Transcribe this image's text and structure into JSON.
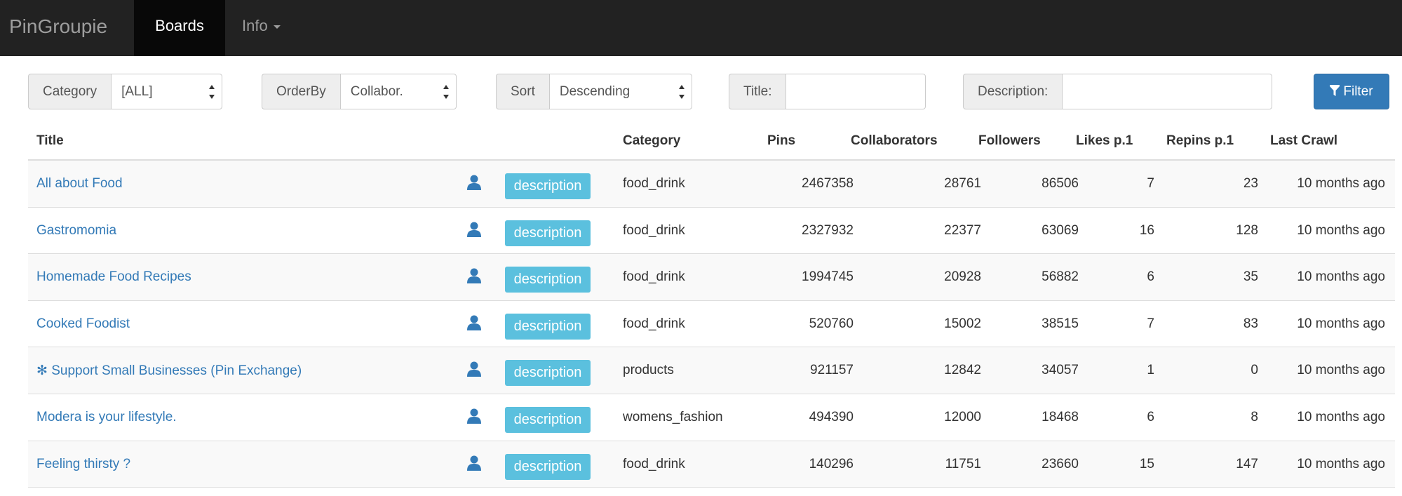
{
  "navbar": {
    "brand": "PinGroupie",
    "active_item": "Boards",
    "info_item": "Info"
  },
  "filters": {
    "category_label": "Category",
    "category_value": "[ALL]",
    "orderby_label": "OrderBy",
    "orderby_value": "Collabor.",
    "sort_label": "Sort",
    "sort_value": "Descending",
    "title_label": "Title:",
    "title_value": "",
    "description_label": "Description:",
    "description_value": "",
    "filter_button": "Filter"
  },
  "colors": {
    "navbar_bg": "#222222",
    "link": "#337ab7",
    "badge": "#5bc0de",
    "primary_button": "#337ab7"
  },
  "table": {
    "headers": {
      "title": "Title",
      "category": "Category",
      "pins": "Pins",
      "collaborators": "Collaborators",
      "followers": "Followers",
      "likes": "Likes p.1",
      "repins": "Repins p.1",
      "last_crawl": "Last Crawl"
    },
    "rows": [
      {
        "title": "All about Food",
        "badge": "description",
        "category": "food_drink",
        "pins": "2467358",
        "collaborators": "28761",
        "followers": "86506",
        "likes": "7",
        "repins": "23",
        "last_crawl": "10 months ago"
      },
      {
        "title": "Gastromomia",
        "badge": "description",
        "category": "food_drink",
        "pins": "2327932",
        "collaborators": "22377",
        "followers": "63069",
        "likes": "16",
        "repins": "128",
        "last_crawl": "10 months ago"
      },
      {
        "title": "Homemade Food Recipes",
        "badge": "description",
        "category": "food_drink",
        "pins": "1994745",
        "collaborators": "20928",
        "followers": "56882",
        "likes": "6",
        "repins": "35",
        "last_crawl": "10 months ago"
      },
      {
        "title": "Cooked Foodist",
        "badge": "description",
        "category": "food_drink",
        "pins": "520760",
        "collaborators": "15002",
        "followers": "38515",
        "likes": "7",
        "repins": "83",
        "last_crawl": "10 months ago"
      },
      {
        "title": "✻ Support Small Businesses (Pin Exchange)",
        "badge": "description",
        "category": "products",
        "pins": "921157",
        "collaborators": "12842",
        "followers": "34057",
        "likes": "1",
        "repins": "0",
        "last_crawl": "10 months ago"
      },
      {
        "title": "Modera is your lifestyle.",
        "badge": "description",
        "category": "womens_fashion",
        "pins": "494390",
        "collaborators": "12000",
        "followers": "18468",
        "likes": "6",
        "repins": "8",
        "last_crawl": "10 months ago"
      },
      {
        "title": "Feeling thirsty ?",
        "badge": "description",
        "category": "food_drink",
        "pins": "140296",
        "collaborators": "11751",
        "followers": "23660",
        "likes": "15",
        "repins": "147",
        "last_crawl": "10 months ago"
      }
    ]
  }
}
